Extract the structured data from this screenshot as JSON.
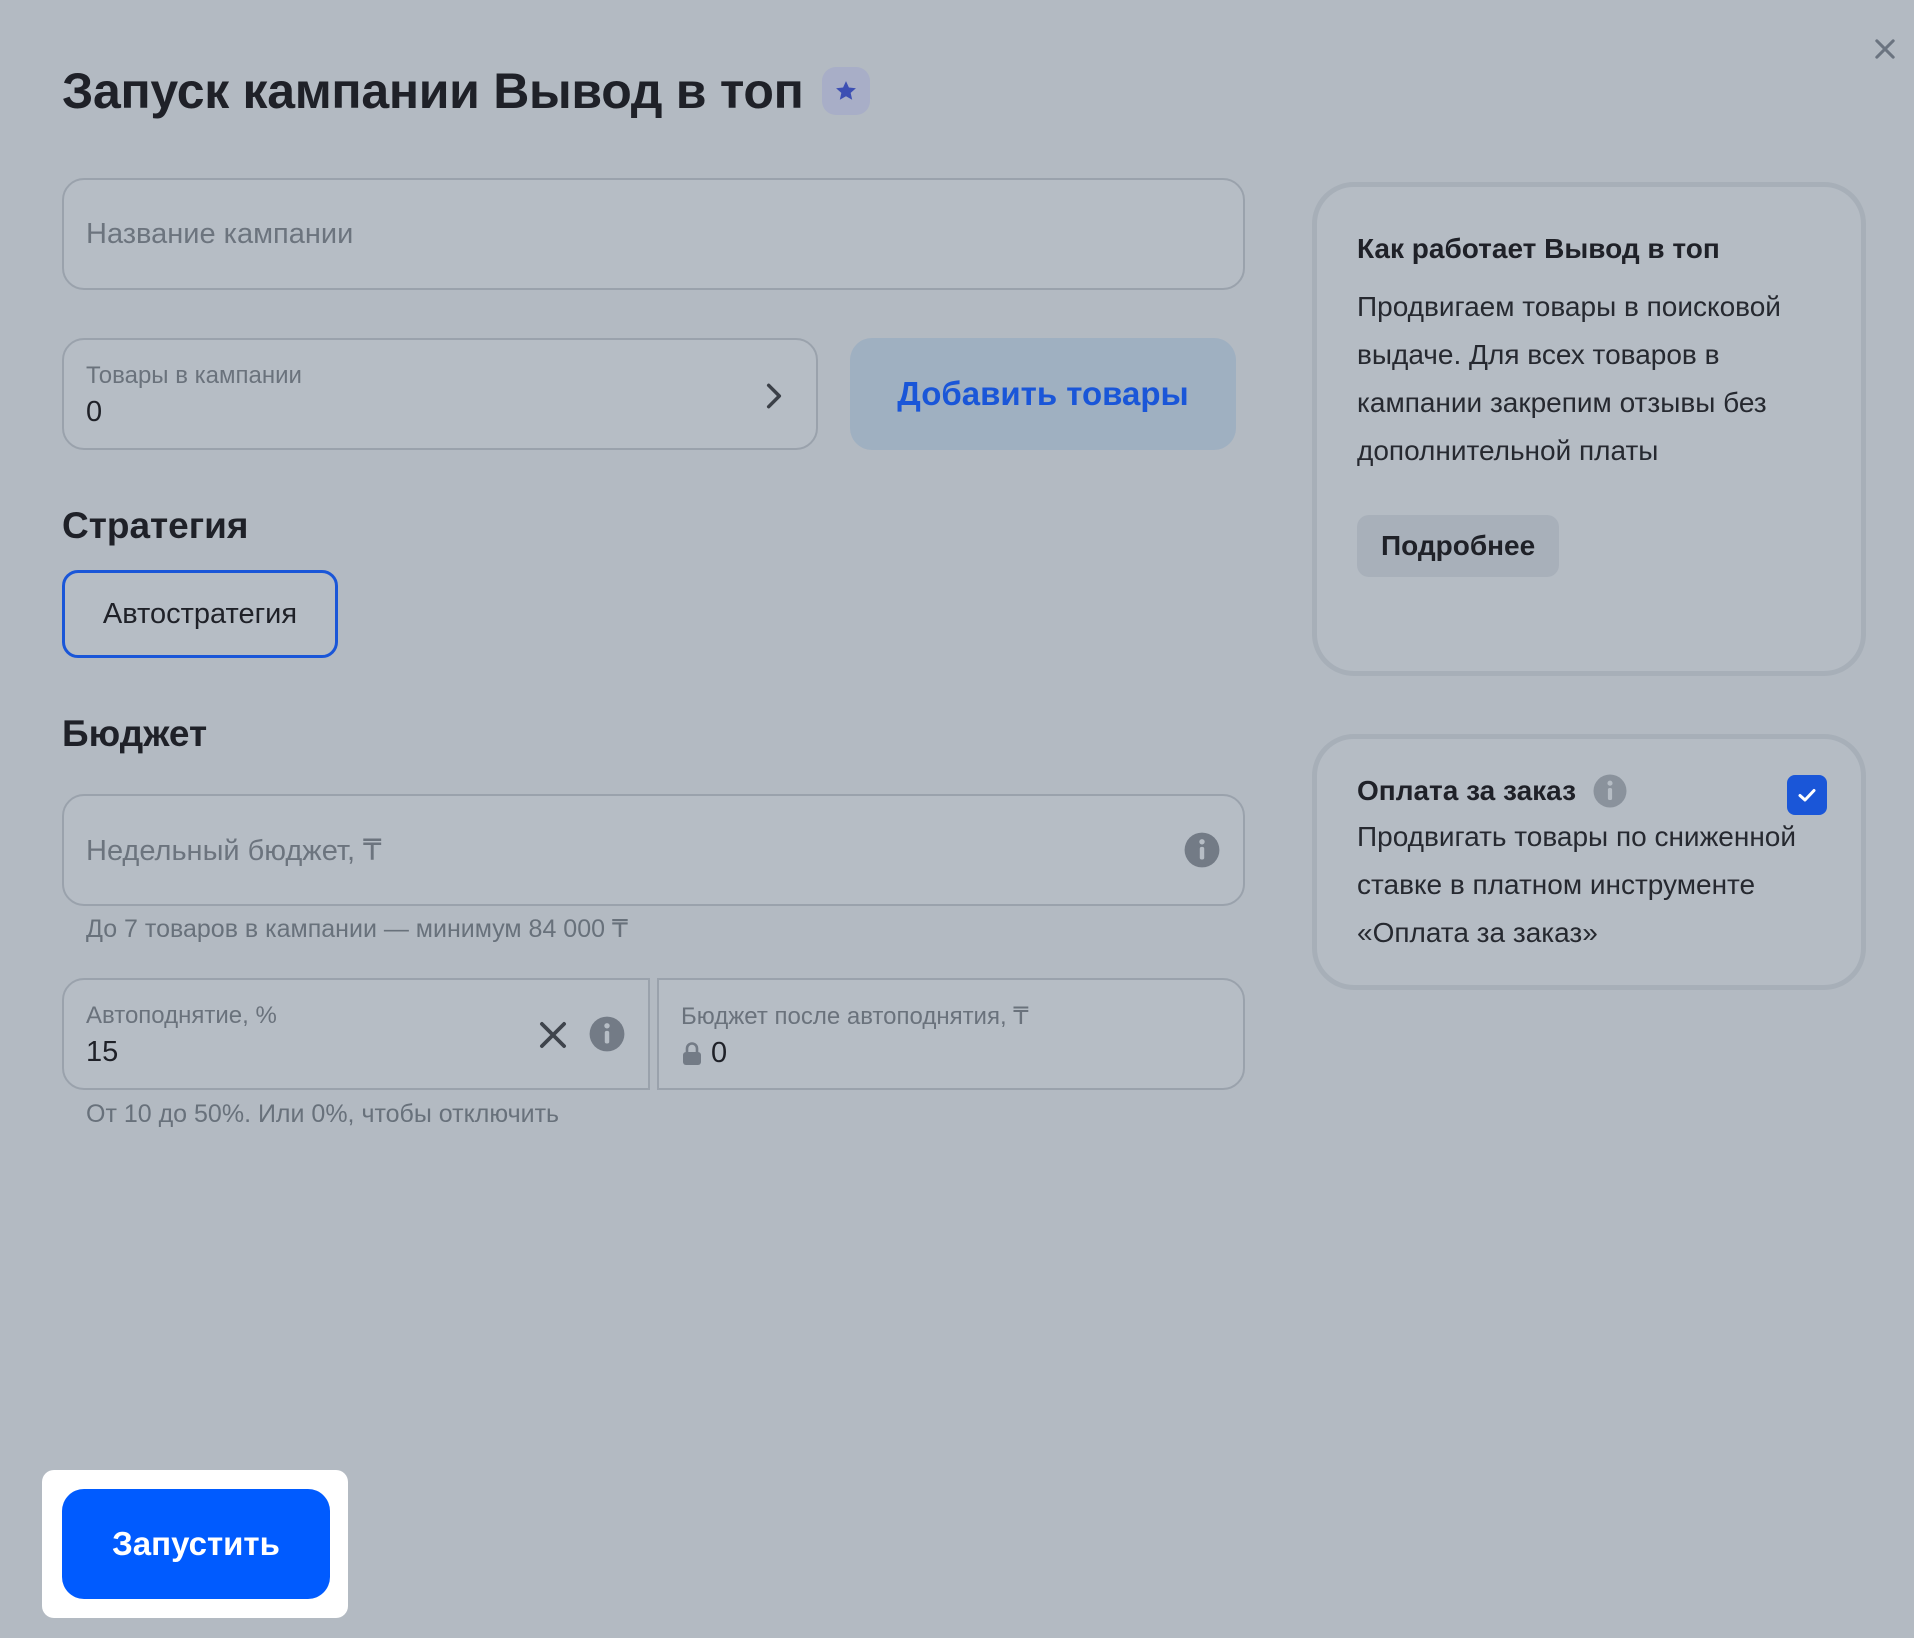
{
  "modal": {
    "title": "Запуск кампании Вывод в топ",
    "close_icon": "close-icon",
    "premium_icon": "star-icon"
  },
  "form": {
    "campaign_name": {
      "placeholder": "Название кампании",
      "value": ""
    },
    "products": {
      "label": "Товары в кампании",
      "value": "0"
    },
    "add_products_label": "Добавить товары",
    "strategy": {
      "title": "Стратегия",
      "selected": "Автостратегия"
    },
    "budget": {
      "title": "Бюджет",
      "weekly_placeholder": "Недельный бюджет, ₸",
      "weekly_hint": "До 7 товаров в кампании — минимум 84 000 ₸",
      "raise_label": "Автоподнятие, %",
      "raise_value": "15",
      "after_label": "Бюджет после автоподнятия, ₸",
      "after_value": "0",
      "raise_hint": "От 10 до 50%. Или 0%, чтобы отключить"
    },
    "launch_label": "Запустить"
  },
  "side": {
    "how_it_works": {
      "title": "Как работает Вывод в топ",
      "text": "Продвигаем товары в поисковой выдаче. Для всех товаров в кампании закрепим отзывы без дополнительной платы",
      "more_label": "Подробнее"
    },
    "pay_per_order": {
      "title": "Оплата за заказ",
      "checked": true,
      "text": "Продвигать товары по сниженной ставке в платном инструменте «Оплата за заказ»"
    }
  },
  "colors": {
    "accent": "#005bff",
    "link": "#1a56d8",
    "overlay_background": "#b3bac2",
    "highlight": "#ffffff"
  }
}
